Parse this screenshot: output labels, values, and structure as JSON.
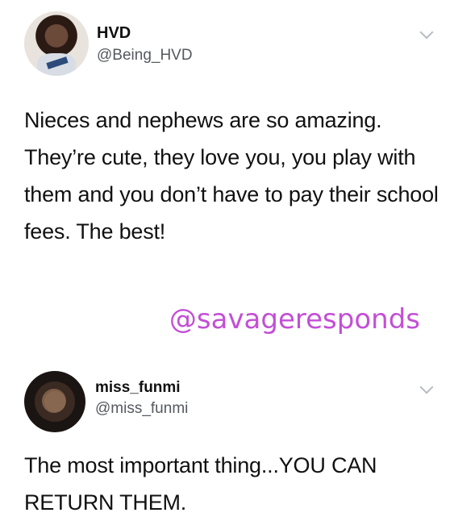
{
  "tweets": [
    {
      "name": "HVD",
      "handle": "@Being_HVD",
      "text": "Nieces and nephews are so amazing. They’re cute, they love you, you play with them and you don’t have to pay their school fees. The best!"
    },
    {
      "name": "miss_funmi",
      "handle": "@miss_funmi",
      "text": "The most important thing...YOU CAN RETURN THEM."
    }
  ],
  "watermark": "@savageresponds",
  "icons": {
    "menu": "chevron-down-icon",
    "avatar": "profile-photo"
  }
}
